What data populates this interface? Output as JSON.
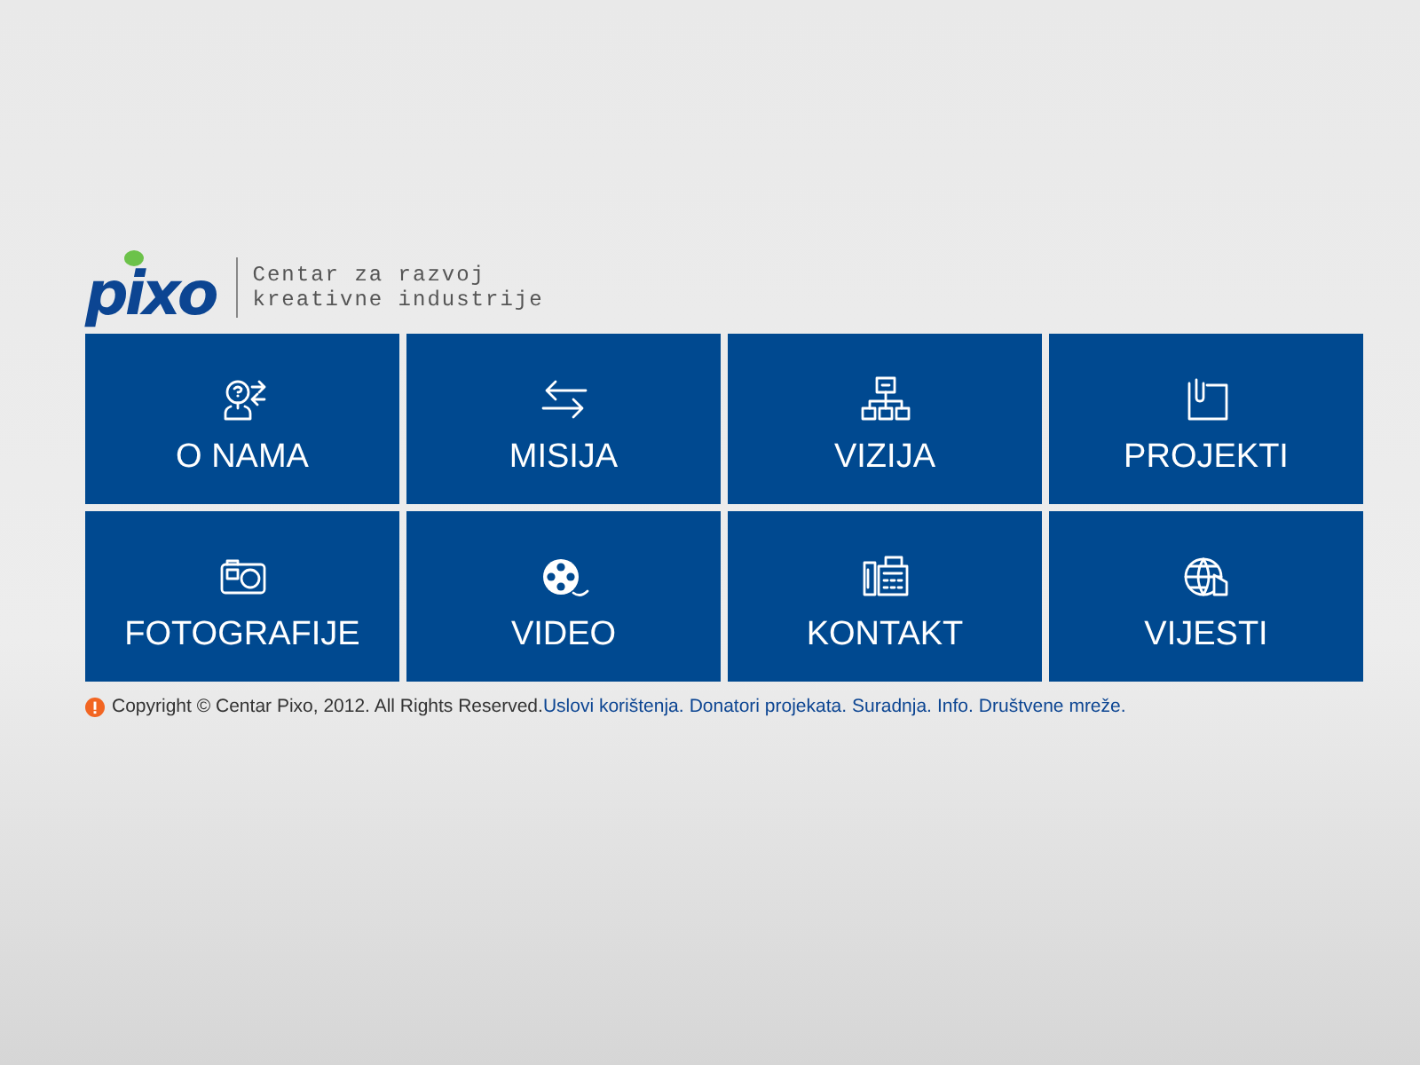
{
  "logo": {
    "name": "pixo",
    "tagline": [
      "Centar za razvoj",
      "kreativne industrije"
    ]
  },
  "tiles": [
    {
      "label": "O NAMA"
    },
    {
      "label": "MISIJA"
    },
    {
      "label": "VIZIJA"
    },
    {
      "label": "PROJEKTI"
    },
    {
      "label": "FOTOGRAFIJE"
    },
    {
      "label": "VIDEO"
    },
    {
      "label": "KONTAKT"
    },
    {
      "label": "VIJESTI"
    }
  ],
  "footer": {
    "copyright": "Copyright © Centar Pixo, 2012. All Rights Reserved.",
    "links": [
      "Uslovi korištenja.",
      "Donatori projekata.",
      "Suradnja.",
      "Info.",
      "Društvene mreže."
    ]
  }
}
